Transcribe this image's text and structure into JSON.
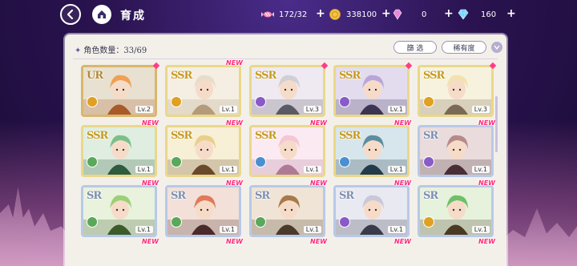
{
  "header": {
    "title": "育成",
    "back_icon": "back-arrow-icon",
    "home_icon": "house-icon"
  },
  "resources": [
    {
      "name": "candy",
      "icon": "candy-icon",
      "value": "172/32"
    },
    {
      "name": "coin",
      "icon": "gold-coin-icon",
      "value": "338100"
    },
    {
      "name": "gem-pink",
      "icon": "pink-gem-icon",
      "value": "0"
    },
    {
      "name": "gem-blue",
      "icon": "blue-diamond-icon",
      "value": "160"
    }
  ],
  "panel": {
    "count_label": "角色数量：33/69",
    "filter_label": "篩 选",
    "rarity_label": "稀有度"
  },
  "colors": {
    "accent_pink": "#ff2a7a",
    "panel_bg": "#f3f0ea"
  },
  "cards": [
    {
      "rank": "UR",
      "level": "Lv.2",
      "new": false,
      "element": "gold",
      "palette": [
        "#f0a050",
        "#a85a2a",
        "#e8e0d0"
      ]
    },
    {
      "rank": "SSR",
      "level": "Lv.1",
      "new": true,
      "element": "gold",
      "palette": [
        "#e8dccb",
        "#b49b7c",
        "#f5efe3"
      ]
    },
    {
      "rank": "SSR",
      "level": "Lv.3",
      "new": false,
      "element": "purple",
      "palette": [
        "#cfcfd6",
        "#5a5a66",
        "#efe9f2"
      ]
    },
    {
      "rank": "SSR",
      "level": "Lv.1",
      "new": false,
      "element": "purple",
      "palette": [
        "#b9a6d8",
        "#3b3552",
        "#e3dcef"
      ]
    },
    {
      "rank": "SSR",
      "level": "Lv.3",
      "new": false,
      "element": "gold",
      "palette": [
        "#f1e2b0",
        "#7a6a55",
        "#f7f2dd"
      ]
    },
    {
      "rank": "SSR",
      "level": "Lv.1",
      "new": true,
      "element": "green",
      "palette": [
        "#7bbf8a",
        "#2f5b3f",
        "#dfeee0"
      ]
    },
    {
      "rank": "SSR",
      "level": "Lv.1",
      "new": true,
      "element": "green",
      "palette": [
        "#e8d08a",
        "#6a4a2a",
        "#f7efd6"
      ]
    },
    {
      "rank": "SSR",
      "level": "Lv.1",
      "new": true,
      "element": "blue",
      "palette": [
        "#f4c6d6",
        "#b07a96",
        "#fbeaf1"
      ]
    },
    {
      "rank": "SSR",
      "level": "Lv.1",
      "new": true,
      "element": "blue",
      "palette": [
        "#5c8ea0",
        "#233b4a",
        "#d7e6ec"
      ]
    },
    {
      "rank": "SR",
      "level": "Lv.1",
      "new": true,
      "element": "purple",
      "palette": [
        "#b78a8a",
        "#4a2e36",
        "#eadcdc"
      ]
    },
    {
      "rank": "SR",
      "level": "Lv.1",
      "new": true,
      "element": "green",
      "palette": [
        "#9ccf76",
        "#3d5a2a",
        "#e8f2dc"
      ]
    },
    {
      "rank": "SR",
      "level": "Lv.1",
      "new": true,
      "element": "green",
      "palette": [
        "#e07a5a",
        "#4a2a2a",
        "#f3e0d8"
      ]
    },
    {
      "rank": "SR",
      "level": "Lv.1",
      "new": true,
      "element": "green",
      "palette": [
        "#a87a4a",
        "#4a3a2a",
        "#efe4d6"
      ]
    },
    {
      "rank": "SR",
      "level": "Lv.1",
      "new": true,
      "element": "purple",
      "palette": [
        "#c8c8d8",
        "#3a3a4a",
        "#e9e9f2"
      ]
    },
    {
      "rank": "SR",
      "level": "Lv.1",
      "new": true,
      "element": "gold",
      "palette": [
        "#6fbf6a",
        "#4a3a22",
        "#e6f2dc"
      ]
    }
  ],
  "partial_row_new": [
    true,
    true,
    true,
    true,
    true
  ]
}
